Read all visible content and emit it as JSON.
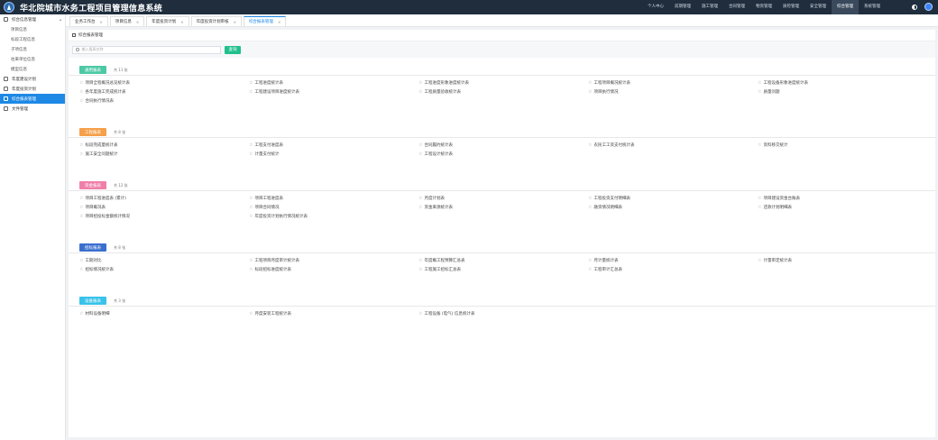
{
  "app": {
    "title": "华北院城市水务工程项目管理信息系统"
  },
  "topnav": {
    "items": [
      "个人中心",
      "前期管理",
      "施工管理",
      "合同管理",
      "物资管理",
      "质检管理",
      "安全管理",
      "综合管理",
      "系统管理"
    ],
    "active_index": 7
  },
  "sidebar": {
    "groups": [
      {
        "label": "综合信息管理",
        "icon": "grid-icon",
        "expanded": true,
        "children": [
          "项目信息",
          "标段工程信息",
          "子项信息",
          "往来单位信息",
          "模型信息"
        ]
      },
      {
        "label": "年度建设计划",
        "icon": "calendar-icon",
        "children": []
      },
      {
        "label": "年度投资计划",
        "icon": "chart-icon",
        "children": []
      },
      {
        "label": "综合报表管理",
        "icon": "report-icon",
        "active": true,
        "children": []
      },
      {
        "label": "文件管理",
        "icon": "folder-icon",
        "children": []
      }
    ]
  },
  "tabs": [
    {
      "label": "业务工作台",
      "active": false
    },
    {
      "label": "项目信息",
      "active": false
    },
    {
      "label": "年度投资计划",
      "active": false
    },
    {
      "label": "年度投资计划审核",
      "active": false
    },
    {
      "label": "综合报表管理",
      "active": true
    }
  ],
  "page": {
    "title": "综合报表管理",
    "search_placeholder": "输入报表名称",
    "query_label": "查询"
  },
  "sections": [
    {
      "label": "通用报表",
      "count": "共 11 张",
      "color": "#4cc9a4",
      "items": [
        "项目全程概况总览统计表",
        "工程进度统计表",
        "工程进度形象进度统计表",
        "工程项目概况统计表",
        "工程设备形象进度统计表",
        "各年度施工完成统计表",
        "工程建设项目进度统计表",
        "工程质量验收统计表",
        "项目执行情况",
        "质量问题",
        "合同执行情况表"
      ]
    },
    {
      "label": "工程报表",
      "count": "共 8 张",
      "color": "#f5a04a",
      "items": [
        "标段完成量统计表",
        "工程支付进度表",
        "合同履约统计表",
        "农民工工资支付统计表",
        "资料移交统计",
        "施工安全问题统计",
        "计量支付统计",
        "工程设计统计表"
      ]
    },
    {
      "label": "资金报表",
      "count": "共 12 张",
      "color": "#ef7fa8",
      "items": [
        "项目工程进度表 (累计)",
        "项目工程进度表",
        "月度计划表",
        "工程投资支付明细表",
        "项目建设资金台账表",
        "项目概况表",
        "项目合同情况",
        "资金来源统计表",
        "融资情况明细表",
        "还款计划明细表",
        "项目招投标金额统计情况",
        "年度投资计划执行情况统计表"
      ]
    },
    {
      "label": "招标报表",
      "count": "共 8 张",
      "color": "#3a6fcf",
      "items": [
        "工期对比",
        "工程项目月度审计统计表",
        "年度概工程预算汇总表",
        "月计量统计表",
        "计量审定统计表",
        "招标情况统计表",
        "标段招标进度统计表",
        "工程施工招标汇总表",
        "工程审计汇总表"
      ]
    },
    {
      "label": "设备报表",
      "count": "共 3 张",
      "color": "#39c2ea",
      "items": [
        "材料设备明细",
        "月度安装工程统计表",
        "工程设备 (电气) 信息统计表"
      ]
    }
  ]
}
